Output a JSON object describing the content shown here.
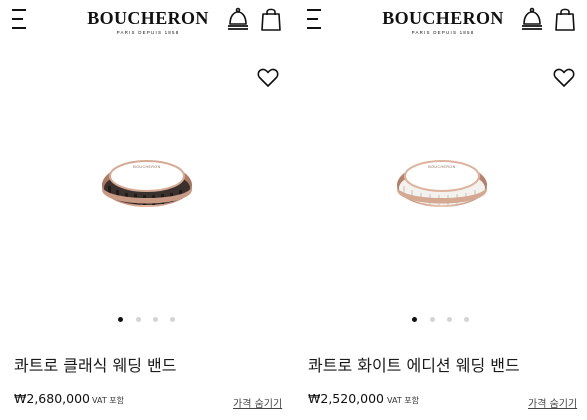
{
  "brand": {
    "name": "BOUCHERON",
    "tagline": "PARIS DEPUIS 1858"
  },
  "icons": {
    "menu": "menu-icon",
    "bell": "bell-icon",
    "bag": "shopping-bag-icon",
    "heart": "heart-icon"
  },
  "products": [
    {
      "name": "콰트로 클래식 웨딩 밴드",
      "price": "₩2,680,000",
      "vat_label": "VAT 포함",
      "hide_price_label": "가격 숨기기",
      "image_count": 4,
      "active_image": 1,
      "ring_color": "#c99a83",
      "inlay_color": "#3a302c",
      "engraving": "BOUCHERON"
    },
    {
      "name": "콰트로 화이트 에디션 웨딩 밴드",
      "price": "₩2,520,000",
      "vat_label": "VAT 포함",
      "hide_price_label": "가격 숨기기",
      "image_count": 4,
      "active_image": 1,
      "ring_color": "#d4a891",
      "inlay_color": "#f4f2ef",
      "engraving": "BOUCHERON"
    }
  ]
}
